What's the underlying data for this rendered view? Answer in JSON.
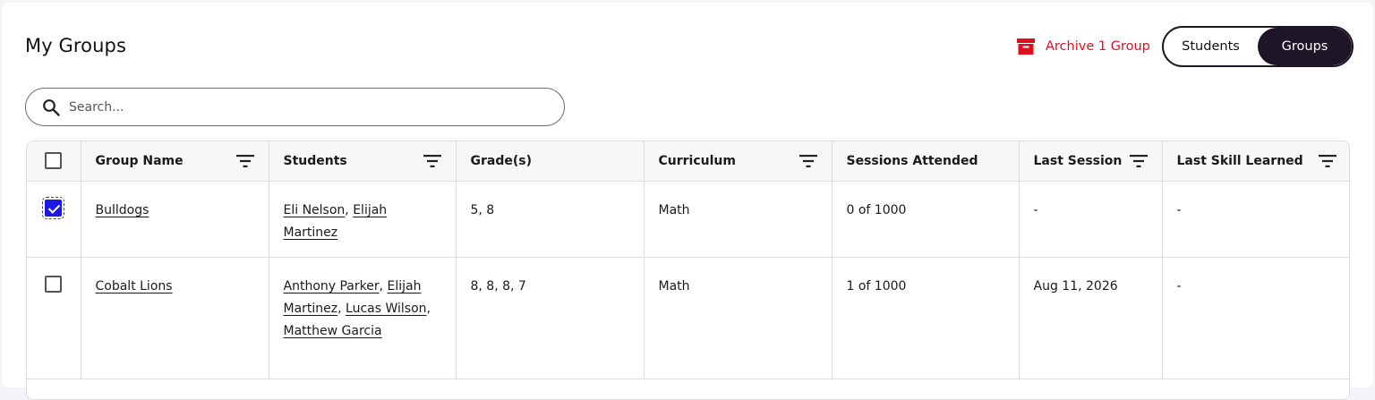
{
  "header": {
    "title": "My Groups",
    "archive_label": "Archive 1 Group",
    "archive_icon": "archive-box-icon",
    "accent_color": "#e00f1f"
  },
  "view_toggle": {
    "options": [
      "Students",
      "Groups"
    ],
    "selected": "Groups"
  },
  "search": {
    "placeholder": "Search...",
    "value": ""
  },
  "table": {
    "columns": [
      {
        "label": "Group Name",
        "filter": true
      },
      {
        "label": "Students",
        "filter": true
      },
      {
        "label": "Grade(s)",
        "filter": false
      },
      {
        "label": "Curriculum",
        "filter": true
      },
      {
        "label": "Sessions Attended",
        "filter": false
      },
      {
        "label": "Last Session",
        "filter": true
      },
      {
        "label": "Last Skill Learned",
        "filter": true
      }
    ],
    "rows": [
      {
        "checked": true,
        "group_name": "Bulldogs",
        "students": [
          "Eli Nelson",
          "Elijah Martinez"
        ],
        "grades": "5, 8",
        "curriculum": "Math",
        "sessions_attended": "0 of 1000",
        "last_session": "-",
        "last_skill": "-"
      },
      {
        "checked": false,
        "group_name": "Cobalt Lions",
        "students": [
          "Anthony Parker",
          "Elijah Martinez",
          "Lucas Wilson",
          "Matthew Garcia"
        ],
        "grades": "8, 8, 8, 7",
        "curriculum": "Math",
        "sessions_attended": "1 of 1000",
        "last_session": "Aug 11, 2026",
        "last_skill": "-"
      }
    ]
  }
}
